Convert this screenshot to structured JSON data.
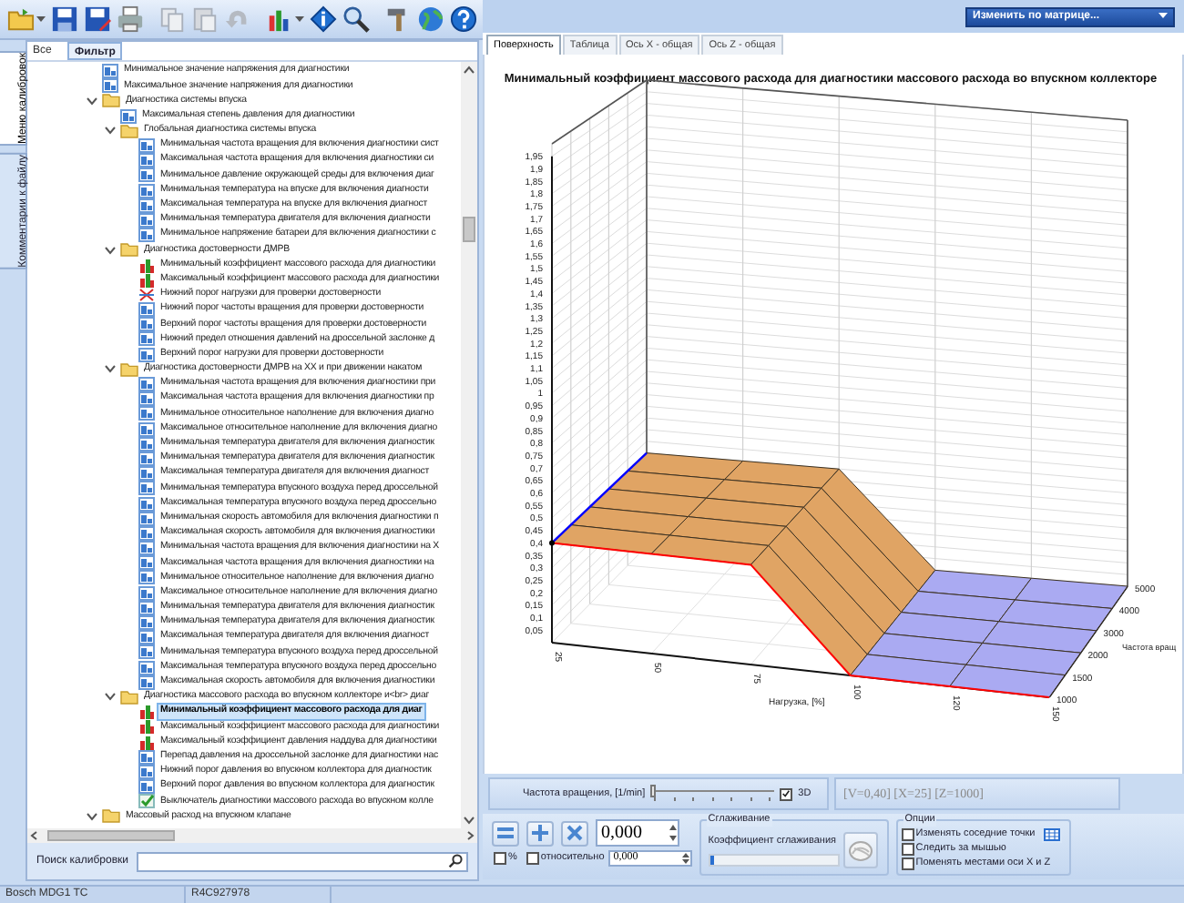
{
  "side_tabs": [
    {
      "label": "Меню калибровок",
      "selected": true
    },
    {
      "label": "Комментарии к файлу",
      "selected": false
    }
  ],
  "tree_header": [
    {
      "label": "Все"
    },
    {
      "label": "Фильтр"
    }
  ],
  "tree": [
    {
      "kind": "table",
      "label": "Минимальное значение напряжения для диагностики"
    },
    {
      "kind": "table",
      "label": "Максимальное значение напряжения для диагностики"
    },
    {
      "kind": "folder",
      "label": "Диагностика системы впуска",
      "expanded": true,
      "children": [
        {
          "kind": "table",
          "label": "Максимальная степень давления для диагностики"
        },
        {
          "kind": "folder",
          "label": "Глобальная диагностика системы впуска",
          "expanded": true,
          "children": [
            {
              "kind": "table",
              "label": "Минимальная частота вращения для включения диагностики сист"
            },
            {
              "kind": "table",
              "label": "Максимальная частота вращения для включения диагностики си"
            },
            {
              "kind": "table",
              "label": "Минимальное давление окружающей среды для включения диаг"
            },
            {
              "kind": "table",
              "label": "Минимальная температура на впуске для включения диагности"
            },
            {
              "kind": "table",
              "label": "Максимальная температура на впуске для включения диагност"
            },
            {
              "kind": "table",
              "label": "Минимальная температура двигателя для включения диагности"
            },
            {
              "kind": "table",
              "label": "Минимальное напряжение батареи для включения диагностики с"
            }
          ]
        },
        {
          "kind": "folder",
          "label": "Диагностика достоверности ДМРВ",
          "expanded": true,
          "children": [
            {
              "kind": "map",
              "label": "Минимальный коэффициент массового расхода для диагностики"
            },
            {
              "kind": "map",
              "label": "Максимальный коэффициент массового расхода для диагностики"
            },
            {
              "kind": "curve",
              "label": "Нижний порог нагрузки для проверки достоверности"
            },
            {
              "kind": "table",
              "label": "Нижний порог частоты вращения для проверки достоверности"
            },
            {
              "kind": "table",
              "label": "Верхний порог частоты вращения для проверки достоверности"
            },
            {
              "kind": "table",
              "label": "Нижний предел отношения давлений на дроссельной заслонке д"
            },
            {
              "kind": "table",
              "label": "Верхний порог нагрузки для проверки достоверности"
            }
          ]
        },
        {
          "kind": "folder",
          "label": "Диагностика достоверности ДМРВ на ХХ и при движении накатом",
          "expanded": true,
          "children": [
            {
              "kind": "table",
              "label": "Минимальная частота вращения для включения диагностики при"
            },
            {
              "kind": "table",
              "label": "Максимальная частота вращения для включения диагностики пр"
            },
            {
              "kind": "table",
              "label": "Минимальное относительное наполнение для включения диагно"
            },
            {
              "kind": "table",
              "label": "Максимальное относительное наполнение для включения диагно"
            },
            {
              "kind": "table",
              "label": "Минимальная температура двигателя для включения диагностик"
            },
            {
              "kind": "table",
              "label": "Минимальная температура двигателя для включения диагностик"
            },
            {
              "kind": "table",
              "label": "Максимальная температура двигателя для включения диагност"
            },
            {
              "kind": "table",
              "label": "Минимальная температура впускного воздуха перед дроссельной"
            },
            {
              "kind": "table",
              "label": "Максимальная температура впускного воздуха перед дроссельно"
            },
            {
              "kind": "table",
              "label": "Минимальная скорость автомобиля для включения диагностики п"
            },
            {
              "kind": "table",
              "label": "Максимальная скорость автомобиля для включения диагностики"
            },
            {
              "kind": "table",
              "label": "Минимальная частота вращения для включения диагностики на Х"
            },
            {
              "kind": "table",
              "label": "Максимальная частота вращения для включения диагностики на"
            },
            {
              "kind": "table",
              "label": "Минимальное относительное наполнение для включения диагно"
            },
            {
              "kind": "table",
              "label": "Максимальное относительное наполнение для включения диагно"
            },
            {
              "kind": "table",
              "label": "Минимальная температура двигателя для включения диагностик"
            },
            {
              "kind": "table",
              "label": "Минимальная температура двигателя для включения диагностик"
            },
            {
              "kind": "table",
              "label": "Максимальная температура двигателя для включения диагност"
            },
            {
              "kind": "table",
              "label": "Минимальная температура впускного воздуха перед дроссельной"
            },
            {
              "kind": "table",
              "label": "Максимальная температура впускного воздуха перед дроссельно"
            },
            {
              "kind": "table",
              "label": "Максимальная скорость автомобиля для включения диагностики"
            }
          ]
        },
        {
          "kind": "folder",
          "label": "Диагностика массового расхода во впускном коллекторе и<br> диаг",
          "expanded": true,
          "children": [
            {
              "kind": "map",
              "label": "Минимальный коэффициент массового расхода для диаг",
              "selected": true
            },
            {
              "kind": "map",
              "label": "Максимальный коэффициент массового расхода для диагностики",
              "selected": false
            },
            {
              "kind": "map",
              "label": "Максимальный коэффициент давления наддува для диагностики",
              "selected": false
            },
            {
              "kind": "table",
              "label": "Перепад давления на дроссельной заслонке для диагностики нас",
              "selected": false
            },
            {
              "kind": "table",
              "label": "Нижний порог давления во впускном коллектора для диагностик",
              "selected": false
            },
            {
              "kind": "table",
              "label": "Верхний порог давления во впускном коллектора для диагностик",
              "selected": false
            },
            {
              "kind": "switch",
              "label": "Выключатель диагностики массового расхода во впускном колле",
              "selected": false
            }
          ]
        }
      ]
    },
    {
      "kind": "folder",
      "label": "Массовый расход на впускном клапане",
      "expanded": true
    }
  ],
  "search": {
    "label": "Поиск калибровки"
  },
  "status_bar": [
    "Bosch MDG1 TC",
    "R4C927978"
  ],
  "matrix_dropdown": {
    "label": "Изменить по матрице..."
  },
  "view_tabs": [
    {
      "label": "Поверхность",
      "selected": true
    },
    {
      "label": "Таблица",
      "selected": false
    },
    {
      "label": "Ось X - общая",
      "selected": false
    },
    {
      "label": "Ось Z - общая",
      "selected": false
    }
  ],
  "chart": {
    "title": "Минимальный коэффициент массового расхода для диагностики массового расхода во впускном коллекторе",
    "y_ticks": [
      "1,95",
      "1,9",
      "1,85",
      "1,8",
      "1,75",
      "1,7",
      "1,65",
      "1,6",
      "1,55",
      "1,5",
      "1,45",
      "1,4",
      "1,35",
      "1,3",
      "1,25",
      "1,2",
      "1,15",
      "1,1",
      "1,05",
      "1",
      "0,95",
      "0,9",
      "0,85",
      "0,8",
      "0,75",
      "0,7",
      "0,65",
      "0,6",
      "0,55",
      "0,5",
      "0,45",
      "0,4",
      "0,35",
      "0,3",
      "0,25",
      "0,2",
      "0,15",
      "0,1",
      "0,05"
    ],
    "x_ticks": [
      "25",
      "50",
      "75",
      "100",
      "120",
      "150"
    ],
    "x_label": "Нагрузка, [%]",
    "z_ticks": [
      "1000",
      "1500",
      "2000",
      "3000",
      "4000",
      "5000"
    ],
    "z_label": "Частота вращ"
  },
  "axis_slider": {
    "label": "Частота вращения, [1/min]",
    "level": 0,
    "three_d": {
      "label": "3D",
      "checked": true
    }
  },
  "readout": "[V=0,40] [X=25] [Z=1000]",
  "edit": {
    "value": "0,000",
    "percent": {
      "label": "%",
      "checked": false
    },
    "relative": {
      "label": "относительно",
      "checked": false
    },
    "relative_value": "0,000"
  },
  "smoothing": {
    "title": "Сглаживание",
    "label": "Коэффициент сглаживания",
    "level": 0.03
  },
  "options": {
    "title": "Опции",
    "items": [
      {
        "label": "Изменять соседние точки",
        "checked": false
      },
      {
        "label": "Следить за мышью",
        "checked": false
      },
      {
        "label": "Поменять местами оси X и Z",
        "checked": false
      }
    ]
  }
}
